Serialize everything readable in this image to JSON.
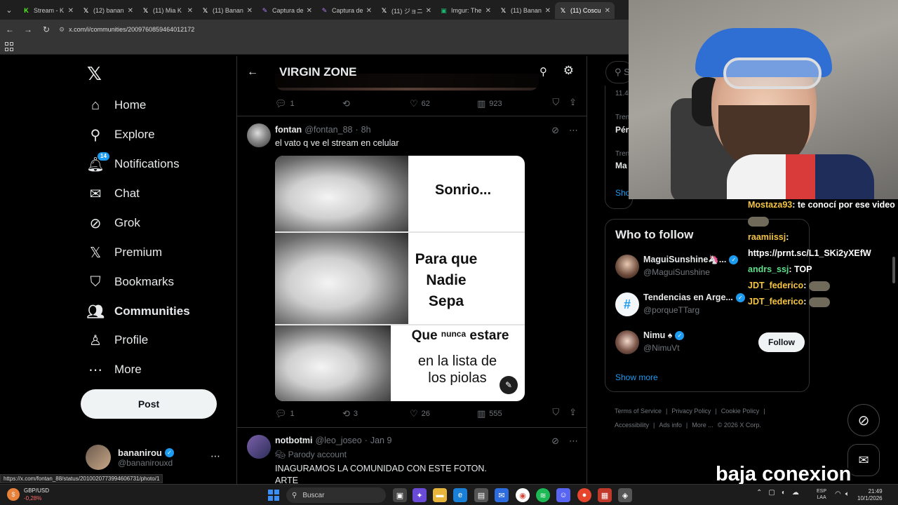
{
  "browser": {
    "tabs": [
      {
        "title": "Stream - K",
        "icon": "kick-icon",
        "color": "#53fc18",
        "active": false
      },
      {
        "title": "(12) banan",
        "icon": "x-icon",
        "color": "#ffffff",
        "active": false
      },
      {
        "title": "(11) Mia K",
        "icon": "x-icon",
        "color": "#ffffff",
        "active": false
      },
      {
        "title": "(11) Banan",
        "icon": "x-icon",
        "color": "#ffffff",
        "active": false
      },
      {
        "title": "Captura de",
        "icon": "pen-icon",
        "color": "#b57cf5",
        "active": false
      },
      {
        "title": "Captura de",
        "icon": "pen-icon",
        "color": "#b57cf5",
        "active": false
      },
      {
        "title": "(11) ジョニ",
        "icon": "x-icon",
        "color": "#ffffff",
        "active": false
      },
      {
        "title": "Imgur: The",
        "icon": "imgur-icon",
        "color": "#1bb76e",
        "active": false
      },
      {
        "title": "(11) Banan",
        "icon": "x-icon",
        "color": "#ffffff",
        "active": false
      },
      {
        "title": "(11) Coscu",
        "icon": "x-icon",
        "color": "#ffffff",
        "active": true
      }
    ],
    "url": "x.com/i/communities/2009760859464012172",
    "status_link": "https://x.com/fontan_88/status/2010020773994606731/photo/1"
  },
  "nav": {
    "items": [
      {
        "label": "Home",
        "icon": "home-icon",
        "glyph": "⌂",
        "bold": false
      },
      {
        "label": "Explore",
        "icon": "search-icon",
        "glyph": "⚲",
        "bold": false
      },
      {
        "label": "Notifications",
        "icon": "bell-icon",
        "glyph": "🔔︎",
        "bold": false
      },
      {
        "label": "Chat",
        "icon": "mail-icon",
        "glyph": "✉",
        "bold": false
      },
      {
        "label": "Grok",
        "icon": "grok-icon",
        "glyph": "⊘",
        "bold": false
      },
      {
        "label": "Premium",
        "icon": "x-premium-icon",
        "glyph": "𝕏",
        "bold": false
      },
      {
        "label": "Bookmarks",
        "icon": "bookmark-icon",
        "glyph": "⛉",
        "bold": false
      },
      {
        "label": "Communities",
        "icon": "communities-icon",
        "glyph": "👥︎",
        "bold": true
      },
      {
        "label": "Profile",
        "icon": "user-icon",
        "glyph": "♙",
        "bold": false
      },
      {
        "label": "More",
        "icon": "more-circle-icon",
        "glyph": "⋯",
        "bold": false
      }
    ],
    "notifications_badge": "14",
    "post_label": "Post",
    "account": {
      "name": "bananirou",
      "handle": "@bananirouxd"
    }
  },
  "community": {
    "title": "VIRGIN ZONE"
  },
  "tweets": {
    "prev_stats": {
      "replies": "1",
      "retweets": "",
      "likes": "62",
      "views": "923"
    },
    "main": {
      "name": "fontan",
      "handle": "@fontan_88",
      "time": "8h",
      "text": "el vato q ve el stream en celular",
      "meme": {
        "line1": "Sonrio...",
        "line2": "Para que",
        "line3": "Nadie",
        "line4": "Sepa",
        "line5a": "Que",
        "line5b": "nunca",
        "line5c": "estare",
        "line6": "en la lista de",
        "line7": "los piolas"
      },
      "stats": {
        "replies": "1",
        "retweets": "3",
        "likes": "26",
        "views": "555"
      }
    },
    "next": {
      "name": "notbotmi",
      "handle": "@leo_joseo",
      "time": "Jan 9",
      "label": "Parody account",
      "text1": "INAGURAMOS LA COMUNIDAD CON ESTE FOTON.",
      "text2": "ARTE"
    }
  },
  "right": {
    "search_placeholder": "S",
    "trends": {
      "count": "11.4",
      "items": [
        {
          "category": "Tren",
          "title": "Pér"
        },
        {
          "category": "Tren",
          "title": "Ma"
        }
      ],
      "show_more": "Sho"
    },
    "who_to_follow": {
      "title": "Who to follow",
      "accounts": [
        {
          "name": "MaguiSunshine🦄...",
          "handle": "@MaguiSunshine"
        },
        {
          "name": "Tendencias en Arge...",
          "handle": "@porqueTTarg"
        },
        {
          "name": "Nimu ♠",
          "handle": "@NimuVt",
          "follow": "Follow"
        }
      ],
      "show_more": "Show more"
    },
    "footer": {
      "links": [
        "Terms of Service",
        "|",
        "Privacy Policy",
        "|",
        "Cookie Policy",
        "|"
      ],
      "links2": [
        "Accessibility",
        "|",
        "Ads info",
        "|",
        "More ...",
        "© 2026 X Corp."
      ]
    }
  },
  "stream_chat": [
    {
      "user": "Mostaza93",
      "msg": ": te conocí por ese video"
    },
    {
      "user": "raamiissj",
      "msg": ":"
    },
    {
      "user": "",
      "msg": "https://prnt.sc/L1_SKi2yXEfW"
    },
    {
      "user": "andrs_ssj",
      "msg": ": TOP"
    },
    {
      "user": "JDT_federico",
      "msg": ":"
    },
    {
      "user": "JDT_federico",
      "msg": ":"
    }
  ],
  "overlay_text": "baja conexion",
  "taskbar": {
    "widget_label": "GBP/USD",
    "widget_value": "-0,28%",
    "search": "Buscar",
    "lang1": "ESP",
    "lang2": "LAA",
    "time": "21:49",
    "date": "10/1/2026"
  }
}
